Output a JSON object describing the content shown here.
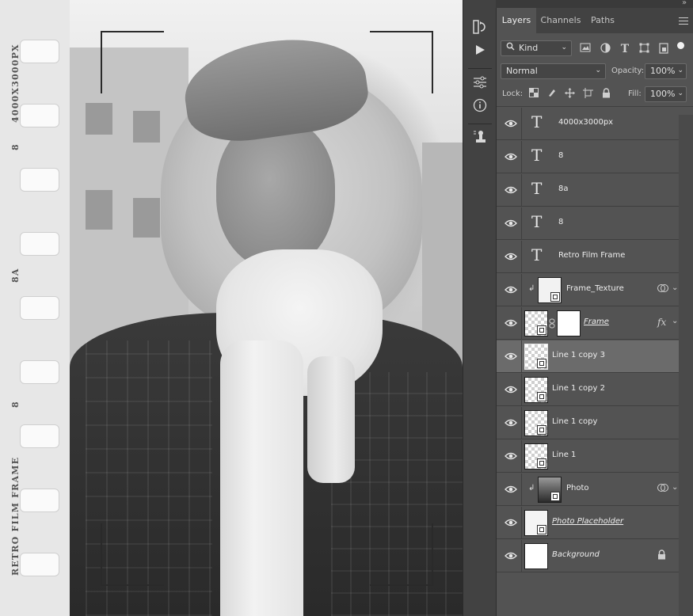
{
  "canvas": {
    "film_strip": {
      "labels": [
        "4000X3000PX",
        "8",
        "8A",
        "8",
        "RETRO FILM FRAME"
      ]
    }
  },
  "panel": {
    "topbar": {
      "collapse_left": "«",
      "collapse_right": "»"
    },
    "tabs": [
      {
        "label": "Layers",
        "active": true
      },
      {
        "label": "Channels",
        "active": false
      },
      {
        "label": "Paths",
        "active": false
      }
    ],
    "menu_icon": "hamburger-icon",
    "filter": {
      "kind_label": "Kind"
    },
    "blend_mode": "Normal",
    "opacity_label": "Opacity:",
    "opacity_value": "100%",
    "lock_label": "Lock:",
    "fill_label": "Fill:",
    "fill_value": "100%",
    "layers": [
      {
        "name": "4000x3000px",
        "type": "text",
        "visible": true
      },
      {
        "name": "8",
        "type": "text",
        "visible": true
      },
      {
        "name": "8a",
        "type": "text",
        "visible": true
      },
      {
        "name": "8",
        "type": "text",
        "visible": true
      },
      {
        "name": "Retro Film Frame",
        "type": "text",
        "visible": true
      },
      {
        "name": "Frame_Texture",
        "type": "smart-object",
        "visible": true,
        "clipped": true
      },
      {
        "name": "Frame",
        "type": "smart-object-mask",
        "visible": true,
        "fx": "fx"
      },
      {
        "name": "Line 1 copy 3",
        "type": "smart-object",
        "visible": true,
        "selected": true
      },
      {
        "name": "Line 1 copy 2",
        "type": "smart-object",
        "visible": true
      },
      {
        "name": "Line 1 copy",
        "type": "smart-object",
        "visible": true
      },
      {
        "name": "Line 1",
        "type": "smart-object",
        "visible": true
      },
      {
        "name": "Photo",
        "type": "smart-object",
        "visible": true,
        "clipped": true
      },
      {
        "name": "Photo Placeholder",
        "type": "smart-object",
        "visible": true
      },
      {
        "name": "Background",
        "type": "background",
        "visible": true,
        "locked": true
      }
    ]
  },
  "colors": {
    "panel_bg": "#535353",
    "selected_row": "#6b6b6b",
    "tab_bar": "#424242"
  }
}
